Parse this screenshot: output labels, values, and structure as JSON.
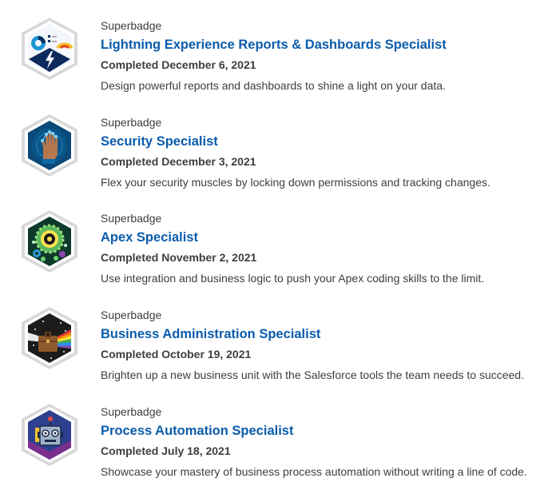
{
  "badges": [
    {
      "kind": "Superbadge",
      "title": "Lightning Experience Reports & Dashboards Specialist",
      "completed": "Completed December 6, 2021",
      "description": "Design powerful reports and dashboards to shine a light on your data.",
      "icon": "reports-dashboards-badge-icon"
    },
    {
      "kind": "Superbadge",
      "title": "Security Specialist",
      "completed": "Completed December 3, 2021",
      "description": "Flex your security muscles by locking down permissions and tracking changes.",
      "icon": "security-hand-badge-icon"
    },
    {
      "kind": "Superbadge",
      "title": "Apex Specialist",
      "completed": "Completed November 2, 2021",
      "description": "Use integration and business logic to push your Apex coding skills to the limit.",
      "icon": "apex-gears-badge-icon"
    },
    {
      "kind": "Superbadge",
      "title": "Business Administration Specialist",
      "completed": "Completed October 19, 2021",
      "description": "Brighten up a new business unit with the Salesforce tools the team needs to succeed.",
      "icon": "briefcase-prism-badge-icon"
    },
    {
      "kind": "Superbadge",
      "title": "Process Automation Specialist",
      "completed": "Completed July 18, 2021",
      "description": "Showcase your mastery of business process automation without writing a line of code.",
      "icon": "robot-badge-icon"
    }
  ],
  "colors": {
    "title_link": "#0b5cab",
    "text": "#3e3e3c",
    "badge_border": "#c9c9c9"
  }
}
